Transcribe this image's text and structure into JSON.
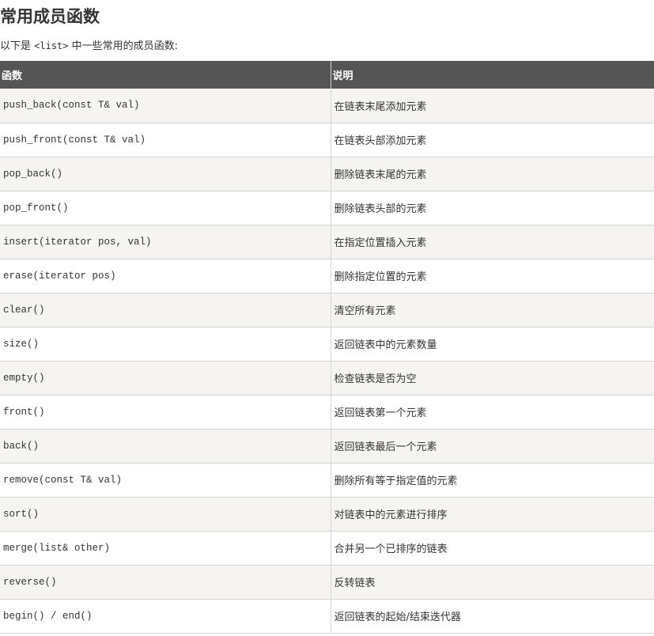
{
  "section": {
    "title": "常用成员函数",
    "intro_prefix": "以下是 ",
    "intro_code": "<list>",
    "intro_suffix": " 中一些常用的成员函数:"
  },
  "table": {
    "headers": [
      "函数",
      "说明"
    ],
    "rows": [
      {
        "function": "push_back(const T& val)",
        "description": "在链表末尾添加元素"
      },
      {
        "function": "push_front(const T& val)",
        "description": "在链表头部添加元素"
      },
      {
        "function": "pop_back()",
        "description": "删除链表末尾的元素"
      },
      {
        "function": "pop_front()",
        "description": "删除链表头部的元素"
      },
      {
        "function": "insert(iterator pos, val)",
        "description": "在指定位置插入元素"
      },
      {
        "function": "erase(iterator pos)",
        "description": "删除指定位置的元素"
      },
      {
        "function": "clear()",
        "description": "清空所有元素"
      },
      {
        "function": "size()",
        "description": "返回链表中的元素数量"
      },
      {
        "function": "empty()",
        "description": "检查链表是否为空"
      },
      {
        "function": "front()",
        "description": "返回链表第一个元素"
      },
      {
        "function": "back()",
        "description": "返回链表最后一个元素"
      },
      {
        "function": "remove(const T& val)",
        "description": "删除所有等于指定值的元素"
      },
      {
        "function": "sort()",
        "description": "对链表中的元素进行排序"
      },
      {
        "function": "merge(list& other)",
        "description": "合并另一个已排序的链表"
      },
      {
        "function": "reverse()",
        "description": "反转链表"
      },
      {
        "function": "begin() / end()",
        "description": "返回链表的起始/结束迭代器"
      }
    ]
  },
  "colors": {
    "header_bg": "#555555",
    "header_text": "#ffffff",
    "row_alt_bg": "#f6f4f0",
    "text": "#333333"
  }
}
